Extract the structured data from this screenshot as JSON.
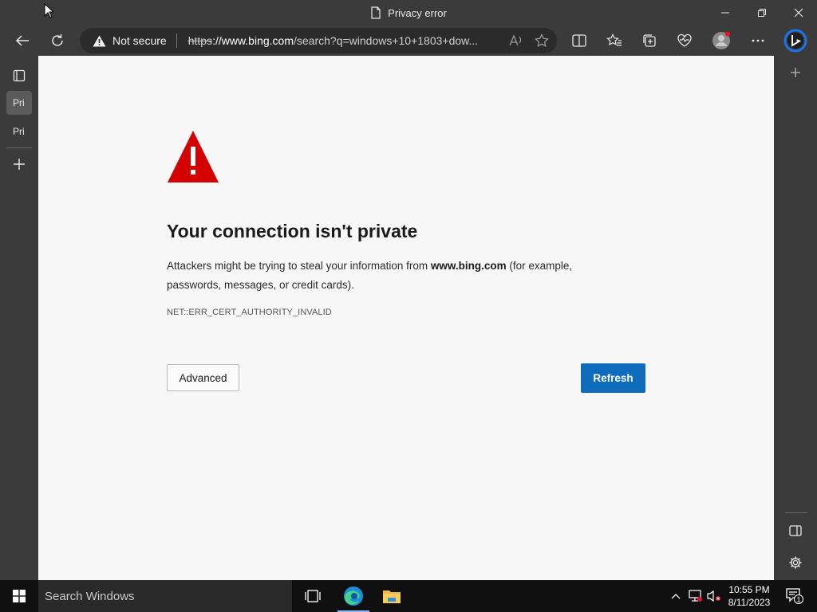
{
  "window": {
    "title": "Privacy error"
  },
  "toolbar": {
    "security_label": "Not secure",
    "url_scheme": "https",
    "url_host": "://www.bing.com",
    "url_rest": "/search?q=windows+10+1803+dow..."
  },
  "tabs": [
    {
      "label": "Pri"
    },
    {
      "label": "Pri"
    }
  ],
  "page": {
    "heading": "Your connection isn't private",
    "desc_before": "Attackers might be trying to steal your information from ",
    "desc_host": "www.bing.com",
    "desc_after": " (for example, passwords, messages, or credit cards).",
    "error_code": "NET::ERR_CERT_AUTHORITY_INVALID",
    "advanced_label": "Advanced",
    "refresh_label": "Refresh"
  },
  "taskbar": {
    "search_placeholder": "Search Windows",
    "time": "10:55 PM",
    "date": "8/11/2023",
    "notification_count": "1"
  },
  "colors": {
    "warning_red": "#d50000",
    "refresh_blue": "#0f6cbd",
    "chrome_bg": "#3b3b3b",
    "page_bg": "#f7f7f7"
  }
}
